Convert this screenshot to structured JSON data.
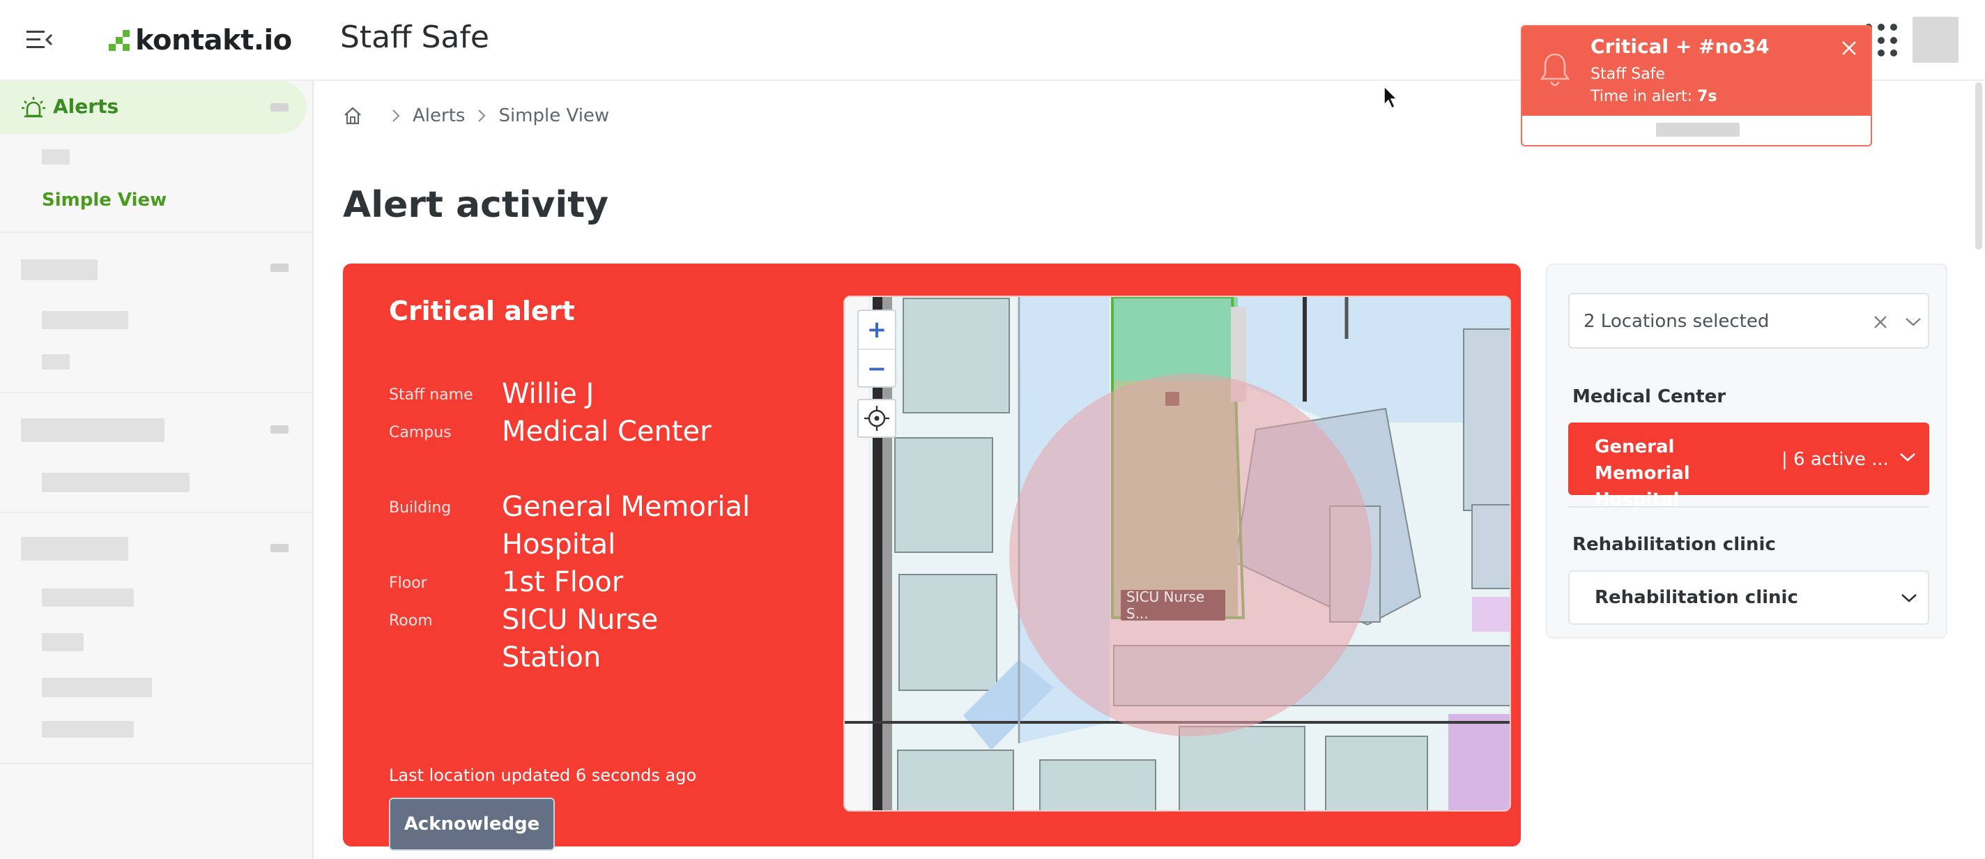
{
  "header": {
    "logo_text": "kontakt.io",
    "app_title": "Staff Safe"
  },
  "sidebar": {
    "active_item": "Alerts",
    "sub_active": "Simple View"
  },
  "breadcrumb": {
    "items": [
      "Alerts",
      "Simple View"
    ]
  },
  "page": {
    "title": "Alert activity"
  },
  "alert": {
    "heading": "Critical alert",
    "labels": {
      "staff": "Staff name",
      "campus": "Campus",
      "building": "Building",
      "floor": "Floor",
      "room": "Room"
    },
    "values": {
      "staff": "Willie J",
      "campus": "Medical Center",
      "building": "General Memorial Hospital",
      "floor": "1st Floor",
      "room": "SICU Nurse Station"
    },
    "last_updated": "Last location updated 6 seconds ago",
    "ack_label": "Acknowledge",
    "map": {
      "zoom_in": "+",
      "zoom_out": "−",
      "room_tag": "SICU Nurse S..."
    }
  },
  "locations": {
    "select_text": "2 Locations selected",
    "groups": [
      {
        "label": "Medical Center",
        "item": "General Memorial Hospital",
        "count": "| 6 active ..."
      },
      {
        "label": "Rehabilitation clinic",
        "item": "Rehabilitation clinic"
      }
    ]
  },
  "toast": {
    "title": "Critical + #no34",
    "subtitle": "Staff Safe",
    "time_label": "Time in alert: ",
    "time_value": "7s"
  },
  "colors": {
    "brand_green": "#4a9a20",
    "alert_red": "#f43c33",
    "toast_red": "#f2604f",
    "ack_button": "#647184"
  }
}
